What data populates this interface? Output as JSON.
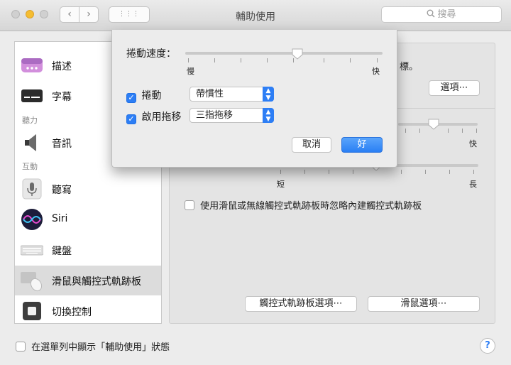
{
  "window": {
    "title": "輔助使用",
    "search_placeholder": "搜尋",
    "back_glyph": "‹",
    "forward_glyph": "›",
    "grid_glyph": "⋮⋮⋮"
  },
  "sidebar": {
    "items": [
      {
        "label": "描述"
      },
      {
        "label": "字幕"
      },
      {
        "label": "音訊"
      },
      {
        "label": "聽寫"
      },
      {
        "label": "Siri"
      },
      {
        "label": "鍵盤"
      },
      {
        "label": "滑鼠與觸控式軌跡板"
      },
      {
        "label": "切換控制"
      }
    ],
    "sections": {
      "hearing": "聽力",
      "interaction": "互動"
    }
  },
  "main": {
    "partial_text": "標。",
    "options_button": "選項⋯",
    "fast_label": "快",
    "short_label": "短",
    "long_label": "長",
    "ignore_builtin_label": "使用滑鼠或無線觸控式軌跡板時忽略內建觸控式軌跡板",
    "trackpad_options_button": "觸控式軌跡板選項⋯",
    "mouse_options_button": "滑鼠選項⋯"
  },
  "sheet": {
    "scroll_speed_label": "捲動速度：",
    "slow_label": "慢",
    "fast_label": "快",
    "scroll_speed_value_fraction": 0.57,
    "scrolling_label": "捲動",
    "scrolling_select": "帶慣性",
    "drag_label": "啟用拖移",
    "drag_select": "三指拖移",
    "cancel_button": "取消",
    "ok_button": "好"
  },
  "footer": {
    "show_in_menu_label": "在選單列中顯示「輔助使用」狀態",
    "help_glyph": "?"
  },
  "colors": {
    "accent": "#2d7ef5"
  }
}
